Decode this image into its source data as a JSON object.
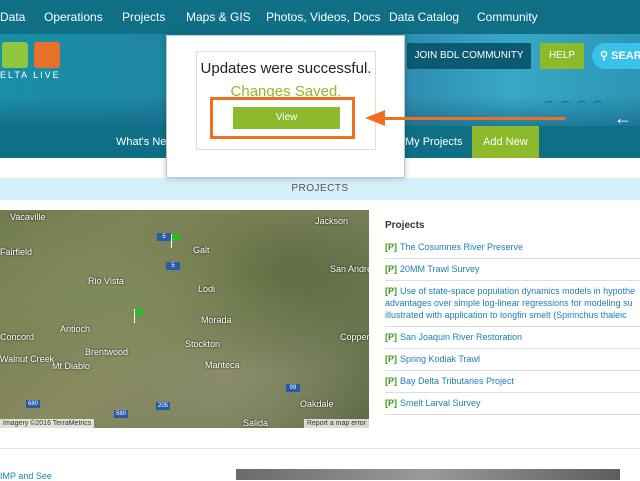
{
  "topnav": {
    "items": [
      "Data",
      "Operations",
      "Projects",
      "Maps & GIS",
      "Photos, Videos, Docs",
      "Data Catalog",
      "Community"
    ]
  },
  "banner": {
    "logo_text": "ELTA LIVE",
    "join_label": "JOIN BDL COMMUNITY",
    "help_label": "HELP",
    "search_label": "SEAR"
  },
  "subnav": {
    "items": [
      "What's Ne",
      "My Projects",
      "Add New"
    ]
  },
  "projects_bar": {
    "title": "PROJECTS"
  },
  "map": {
    "labels": [
      "Vacaville",
      "Jackson",
      "Fairfield",
      "Galt",
      "San Andreas",
      "Rio Vista",
      "Lodi",
      "Antioch",
      "Concord",
      "Brentwood",
      "Morada",
      "Stockton",
      "Coppero",
      "Walnut Creek",
      "Mt Diablo",
      "Manteca",
      "Oakdale",
      "Salida"
    ],
    "shields": [
      "5",
      "5",
      "680",
      "580",
      "205",
      "99"
    ],
    "attribution": "Imagery ©2016 TerraMetrics",
    "report": "Report a map error"
  },
  "projects_list": {
    "heading": "Projects",
    "prefix": "[P]",
    "items": [
      "The Cosumnes River Preserve",
      "20MM Trawl Survey",
      "Use of state-space population dynamics models in hypothe advantages over simple log-linear regressions for modeling su illustrated with application to longfin smelt (Spirinchus thaleic",
      "San Joaquin River Restoration",
      "Spring Kodiak Trawl",
      "Bay Delta Tributaries Project",
      "Smelt Larval Survey"
    ]
  },
  "bottom": {
    "text": "IMP and See"
  },
  "modal": {
    "message": "Updates were successful.",
    "saved": "Changes Saved.",
    "view_label": "View"
  },
  "colors": {
    "nav": "#0e6f87",
    "accent_green": "#8cba2a",
    "highlight": "#f07020",
    "link": "#1c7fb4"
  }
}
